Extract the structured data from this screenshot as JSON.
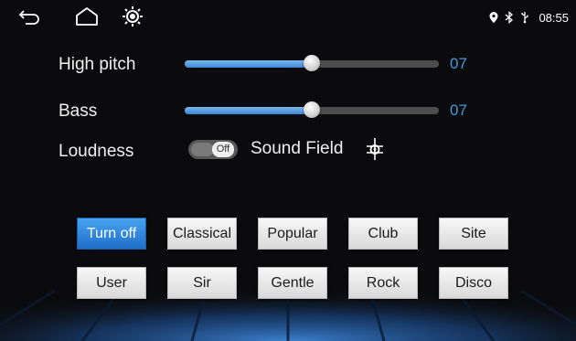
{
  "status_bar": {
    "time": "08:55",
    "nav_icons": [
      "back-icon",
      "home-icon",
      "brightness-icon"
    ],
    "status_icons": [
      "location-icon",
      "bluetooth-icon",
      "usb-icon"
    ]
  },
  "high_pitch": {
    "label": "High pitch",
    "value_text": "07",
    "level": 0.5
  },
  "bass": {
    "label": "Bass",
    "value_text": "07",
    "level": 0.5
  },
  "loudness": {
    "label": "Loudness",
    "state": "Off"
  },
  "sound_field": {
    "label": "Sound Field",
    "icon": "speaker-position-icon"
  },
  "presets": {
    "selected": "Turn off",
    "row1": [
      "Turn off",
      "Classical",
      "Popular",
      "Club",
      "Site"
    ],
    "row2": [
      "User",
      "Sir",
      "Gentle",
      "Rock",
      "Disco"
    ]
  },
  "colors": {
    "accent": "#3c9be0",
    "selected_button": "#2f86dc",
    "track": "#4c4c4c"
  }
}
